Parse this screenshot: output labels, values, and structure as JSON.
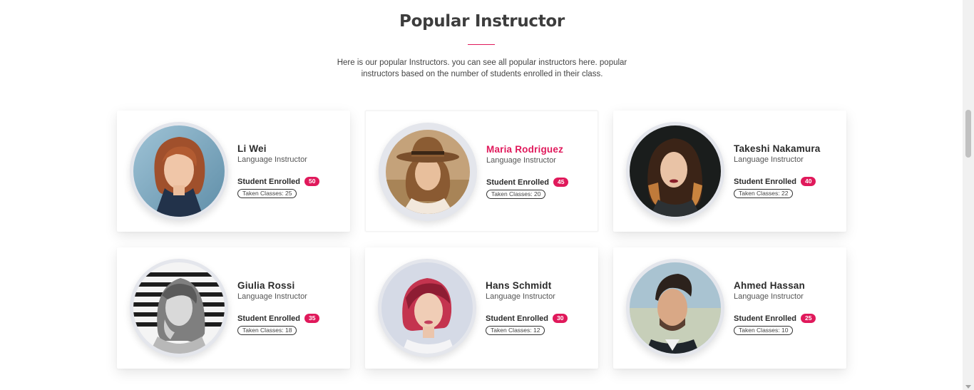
{
  "section": {
    "title": "Popular Instructor",
    "subtitle_line1": "Here is our popular Instructors. you can see all popular instructors here. popular",
    "subtitle_line2": "instructors based on the number of students enrolled in their class."
  },
  "labels": {
    "enrolled": "Student Enrolled"
  },
  "instructors": [
    {
      "name": "Li Wei",
      "role": "Language Instructor",
      "enrolled": "50",
      "classes": "Taken Classes: 25"
    },
    {
      "name": "Maria Rodriguez",
      "role": "Language Instructor",
      "enrolled": "45",
      "classes": "Taken Classes: 20"
    },
    {
      "name": "Takeshi Nakamura",
      "role": "Language Instructor",
      "enrolled": "40",
      "classes": "Taken Classes: 22"
    },
    {
      "name": "Giulia Rossi",
      "role": "Language Instructor",
      "enrolled": "35",
      "classes": "Taken Classes: 18"
    },
    {
      "name": "Hans Schmidt",
      "role": "Language Instructor",
      "enrolled": "30",
      "classes": "Taken Classes: 12"
    },
    {
      "name": "Ahmed Hassan",
      "role": "Language Instructor",
      "enrolled": "25",
      "classes": "Taken Classes: 10"
    }
  ],
  "colors": {
    "accent": "#e0195b"
  }
}
